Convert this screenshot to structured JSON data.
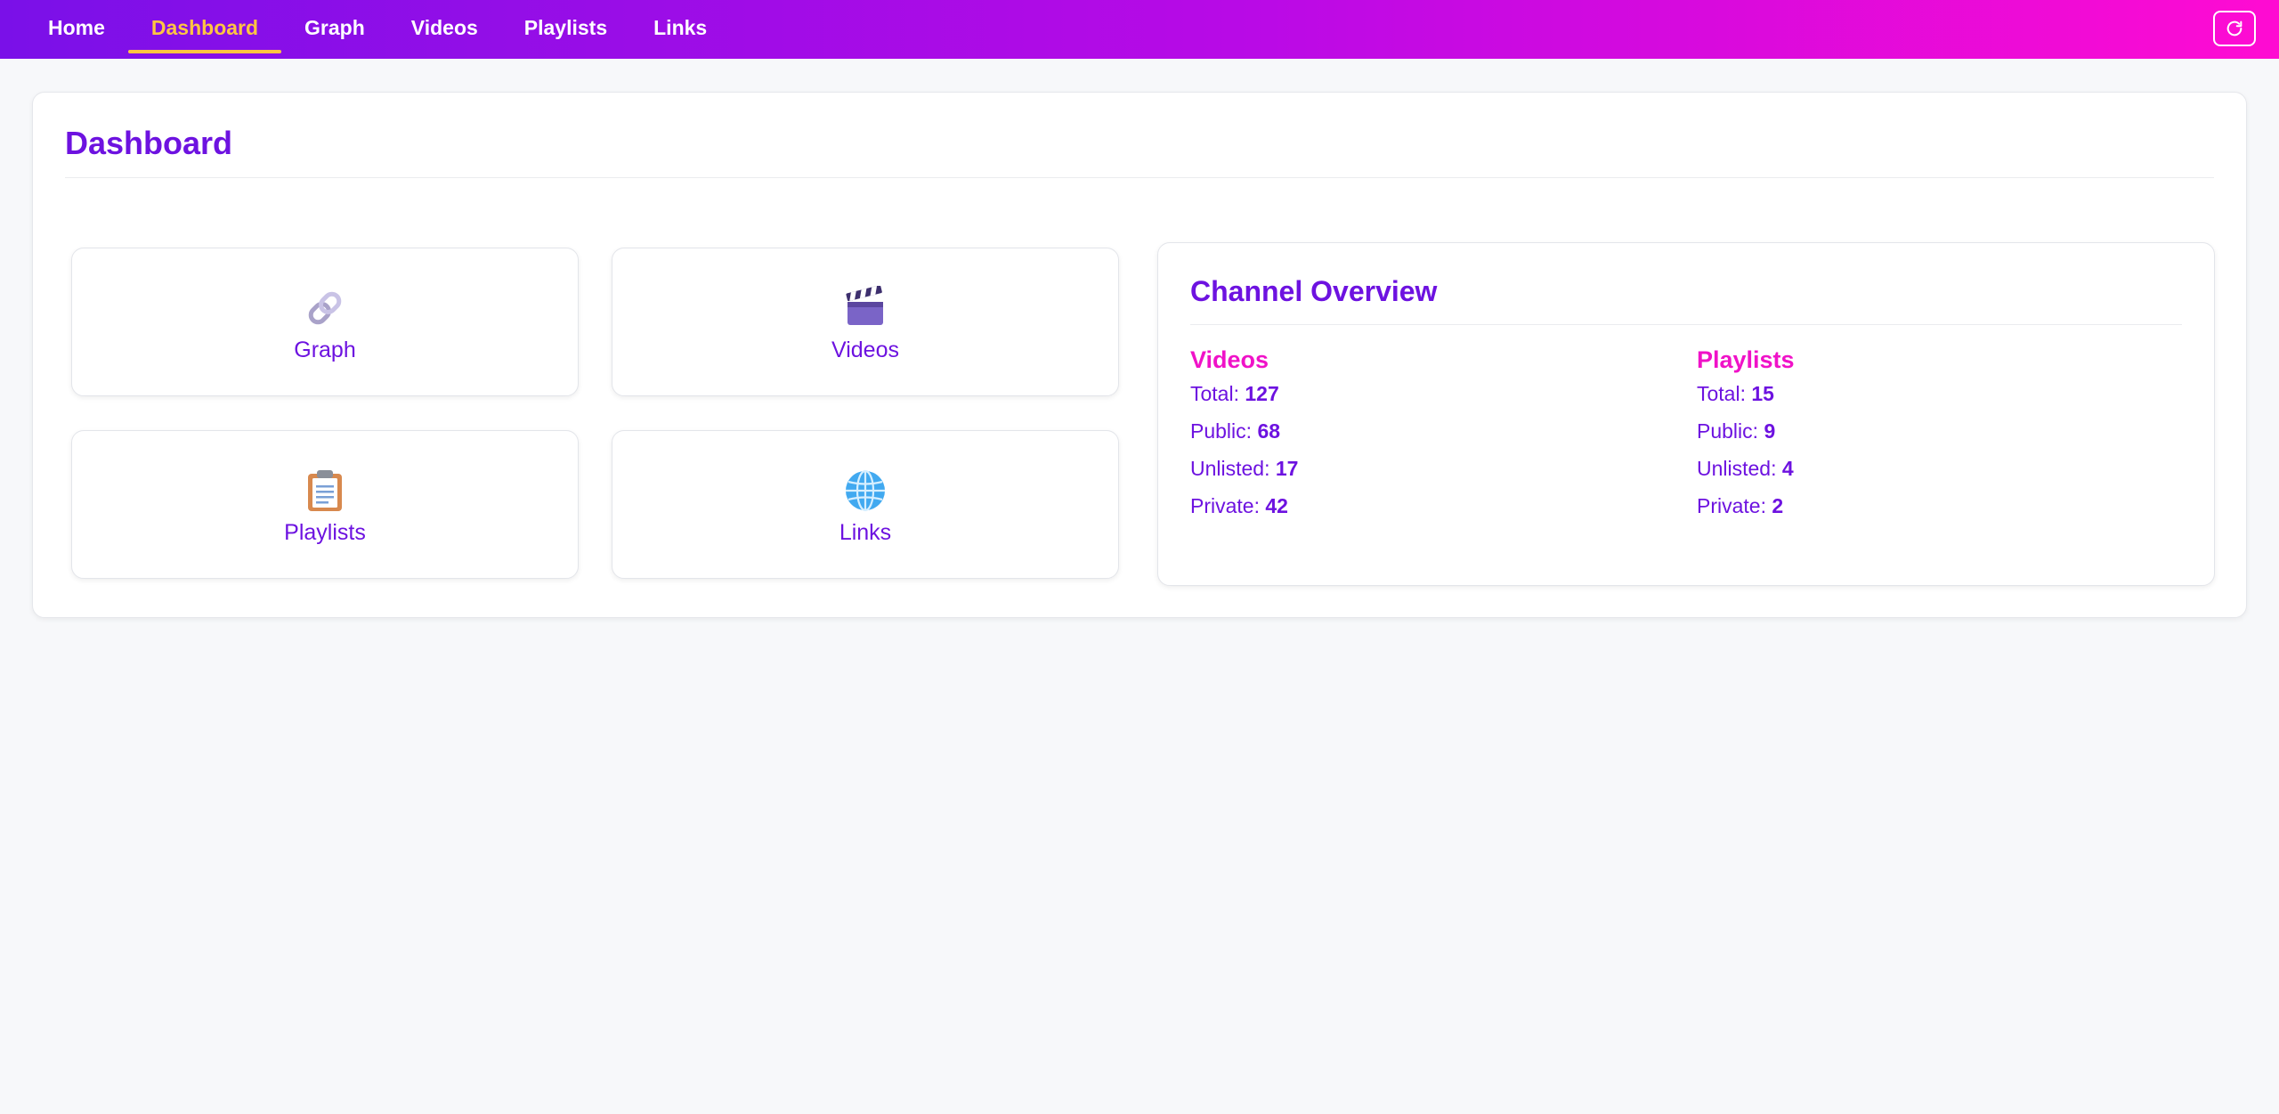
{
  "nav": {
    "items": [
      {
        "label": "Home"
      },
      {
        "label": "Dashboard"
      },
      {
        "label": "Graph"
      },
      {
        "label": "Videos"
      },
      {
        "label": "Playlists"
      },
      {
        "label": "Links"
      }
    ],
    "active": "Dashboard",
    "refresh_icon": "refresh-icon"
  },
  "page": {
    "title": "Dashboard"
  },
  "tiles": [
    {
      "label": "Graph",
      "icon": "link-icon"
    },
    {
      "label": "Videos",
      "icon": "clapperboard-icon"
    },
    {
      "label": "Playlists",
      "icon": "clipboard-icon"
    },
    {
      "label": "Links",
      "icon": "globe-icon"
    }
  ],
  "overview": {
    "title": "Channel Overview",
    "videos": {
      "heading": "Videos",
      "total_label": "Total:",
      "total": "127",
      "public_label": "Public:",
      "public": "68",
      "unlisted_label": "Unlisted:",
      "unlisted": "17",
      "private_label": "Private:",
      "private": "42"
    },
    "playlists": {
      "heading": "Playlists",
      "total_label": "Total:",
      "total": "15",
      "public_label": "Public:",
      "public": "9",
      "unlisted_label": "Unlisted:",
      "unlisted": "4",
      "private_label": "Private:",
      "private": "2"
    }
  },
  "colors": {
    "accent": "#6d12e0",
    "highlight": "#f012c8",
    "active_nav": "#ffc542",
    "nav_gradient_start": "#7a10e8",
    "nav_gradient_end": "#ff0bd2"
  }
}
